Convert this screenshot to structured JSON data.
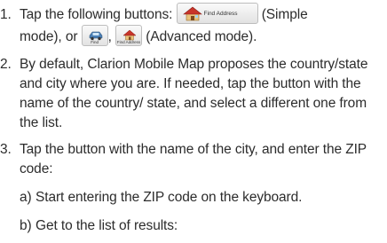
{
  "steps": [
    {
      "number": "1.",
      "text_before": "Tap the following buttons: ",
      "button_simple_label": "Find Address",
      "text_mid1": " (Simple",
      "text_line2a": "mode), or ",
      "button_find_label": "Find",
      "text_comma": ", ",
      "button_find_address_small_label": "Find Address",
      "text_line2b": " (Advanced mode)."
    },
    {
      "number": "2.",
      "text": "By default, Clarion Mobile Map proposes the country/state and city where you are. If needed, tap the button with the name of the country/ state, and select a different one from the list."
    },
    {
      "number": "3.",
      "text": "Tap the button with the name of the city, and enter the ZIP code:",
      "substeps": [
        {
          "letter": "a)",
          "text": "Start entering the ZIP code on the keyboard."
        },
        {
          "letter": "b)",
          "text": "Get to the list of results:"
        }
      ]
    }
  ],
  "icons": {
    "house": "house-icon",
    "car": "car-icon",
    "house_small": "house-small-icon"
  },
  "colors": {
    "roof": "#c8352a",
    "wall": "#e9c27a",
    "car": "#4a7fb5"
  }
}
